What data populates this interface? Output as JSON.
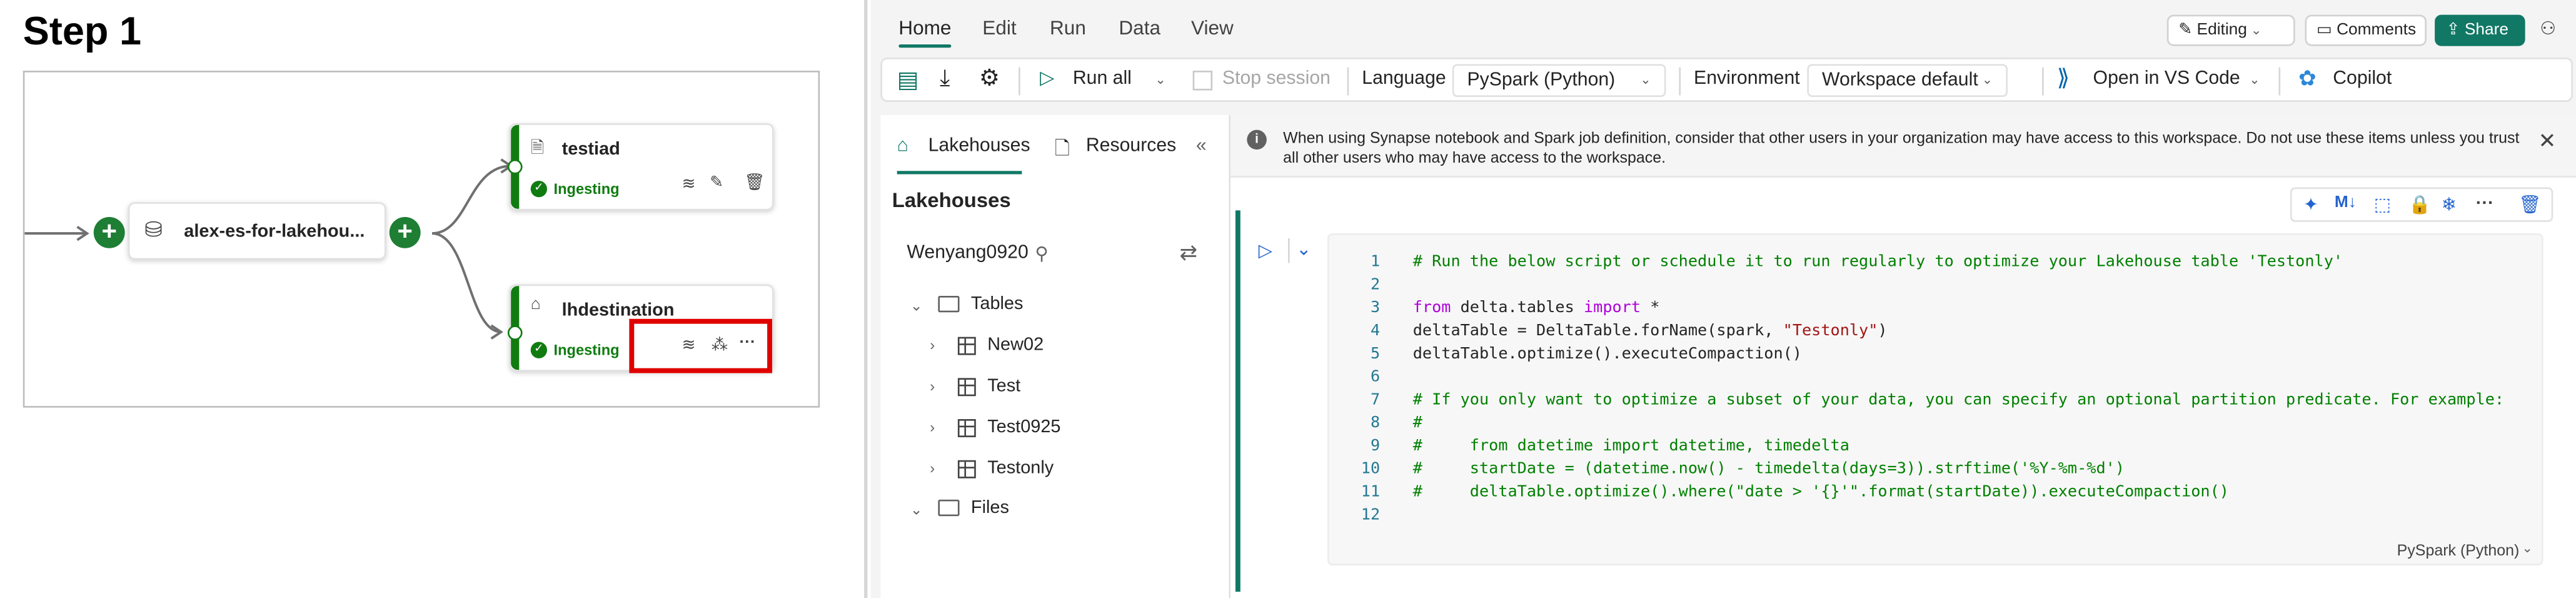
{
  "step": {
    "title": "Step 1"
  },
  "pipeline": {
    "source": {
      "title": "alex-es-for-lakehou..."
    },
    "destinations": [
      {
        "title": "testiad",
        "status": "Ingesting"
      },
      {
        "title": "lhdestination",
        "status": "Ingesting"
      }
    ],
    "highlight_color": "#e00000",
    "accent_color": "#107c10"
  },
  "menu": {
    "tabs": [
      "Home",
      "Edit",
      "Run",
      "Data",
      "View"
    ],
    "editing": "Editing",
    "comments": "Comments",
    "share": "Share"
  },
  "toolbar": {
    "run_all": "Run all",
    "stop_session": "Stop session",
    "language_label": "Language",
    "language_value": "PySpark (Python)",
    "environment_label": "Environment",
    "environment_value": "Workspace default",
    "vscode": "Open in VS Code",
    "copilot": "Copilot"
  },
  "explorer": {
    "tabs": [
      "Lakehouses",
      "Resources"
    ],
    "heading": "Lakehouses",
    "lakehouse_name": "Wenyang0920",
    "tables_label": "Tables",
    "tables": [
      "New02",
      "Test",
      "Test0925",
      "Testonly"
    ],
    "files_label": "Files"
  },
  "notice": "When using Synapse notebook and Spark job definition, consider that other users in your organization may have access to this workspace. Do not use these items unless you trust all other users who may have access to the workspace.",
  "cell": {
    "language": "PySpark (Python)",
    "lines": [
      {
        "n": "1",
        "parts": [
          [
            "cm",
            "# Run the below script or schedule it to run regularly to optimize your Lakehouse table 'Testonly'"
          ]
        ]
      },
      {
        "n": "2",
        "parts": []
      },
      {
        "n": "3",
        "parts": [
          [
            "kw",
            "from"
          ],
          [
            "tx",
            " delta.tables "
          ],
          [
            "kw",
            "import"
          ],
          [
            "tx",
            " *"
          ]
        ]
      },
      {
        "n": "4",
        "parts": [
          [
            "tx",
            "deltaTable = DeltaTable.forName(spark, "
          ],
          [
            "st",
            "\"Testonly\""
          ],
          [
            "tx",
            ")"
          ]
        ]
      },
      {
        "n": "5",
        "parts": [
          [
            "tx",
            "deltaTable.optimize().executeCompaction()"
          ]
        ]
      },
      {
        "n": "6",
        "parts": []
      },
      {
        "n": "7",
        "parts": [
          [
            "cm",
            "# If you only want to optimize a subset of your data, you can specify an optional partition predicate. For example:"
          ]
        ]
      },
      {
        "n": "8",
        "parts": [
          [
            "cm",
            "#"
          ]
        ]
      },
      {
        "n": "9",
        "parts": [
          [
            "cm",
            "#     from datetime import datetime, timedelta"
          ]
        ]
      },
      {
        "n": "10",
        "parts": [
          [
            "cm",
            "#     startDate = (datetime.now() - timedelta(days=3)).strftime('%Y-%m-%d')"
          ]
        ]
      },
      {
        "n": "11",
        "parts": [
          [
            "cm",
            "#     deltaTable.optimize().where(\"date > '{}'\".format(startDate)).executeCompaction()"
          ]
        ]
      },
      {
        "n": "12",
        "parts": []
      }
    ]
  },
  "icons": {
    "copilot_color": "#2b88d8",
    "vscode_color": "#0065a9",
    "run_color": "#117865"
  }
}
